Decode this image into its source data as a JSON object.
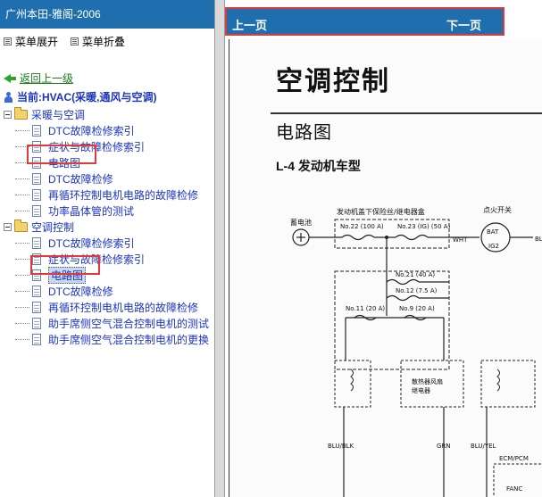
{
  "left_panel": {
    "title": "广州本田-雅阁-2006",
    "menu": {
      "expand_label": "菜单展开",
      "collapse_label": "菜单折叠"
    },
    "back_label": "返回上一级",
    "current_label": "当前:HVAC(采暖,通风与空调)",
    "tree": [
      {
        "label": "采暖与空调",
        "children": [
          "DTC故障检修索引",
          "症状与故障检修索引",
          "电路图",
          "DTC故障检修",
          "再循环控制电机电路的故障检修",
          "功率晶体管的测试"
        ]
      },
      {
        "label": "空调控制",
        "children": [
          "DTC故障检修索引",
          "症状与故障检修索引",
          "电路图",
          "DTC故障检修",
          "再循环控制电机电路的故障检修",
          "助手席侧空气混合控制电机的测试",
          "助手席侧空气混合控制电机的更换"
        ]
      }
    ]
  },
  "nav": {
    "prev_label": "上一页",
    "next_label": "下一页"
  },
  "document": {
    "title": "空调控制",
    "section": "电路图",
    "figure_title": "L-4 发动机车型",
    "diagram": {
      "box_label": "发动机盖下保险丝/继电器盒",
      "battery_label": "蓄电池",
      "ignition_label": "点火开关",
      "bat_label": "BAT",
      "ig2_label": "IG2",
      "wht_label": "WHT",
      "blu_label": "BLU",
      "fuse22": "No.22 (100 A)",
      "fuse23": "No.23 (IG) (50 A)",
      "fuse21": "No.21 (40 A)",
      "fuse12": "No.12 (7.5 A)",
      "fuse11": "No.11 (20 A)",
      "fuse9": "No.9 (20 A)",
      "relay_label_1": "散热器风扇",
      "relay_label_2": "继电器",
      "wire_1": "BLU/BLK",
      "wire_2": "GRN",
      "wire_3": "BLU/YEL",
      "ecm_label": "ECM/PCM",
      "fanc_label": "FANC"
    }
  }
}
